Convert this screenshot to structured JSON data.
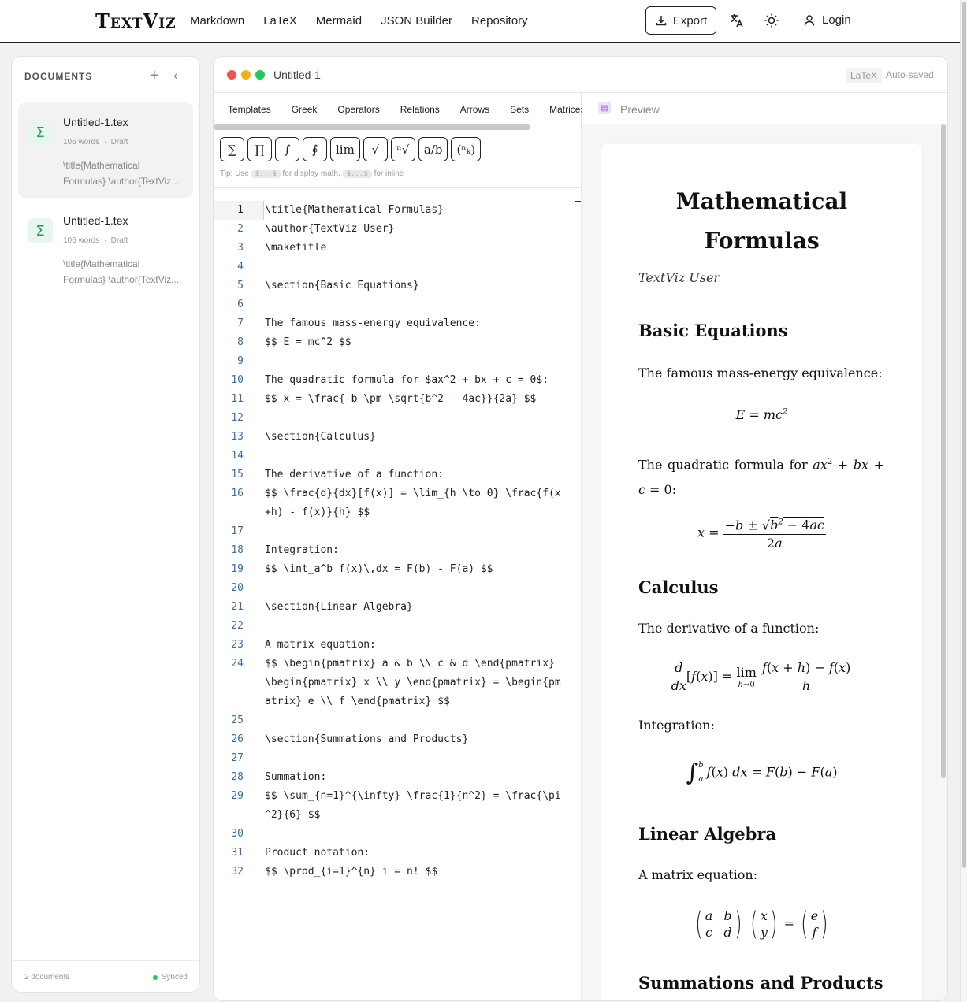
{
  "nav": {
    "brand": "TextViz",
    "links": [
      "Markdown",
      "LaTeX",
      "Mermaid",
      "JSON Builder",
      "Repository"
    ],
    "export_label": "Export",
    "login_label": "Login",
    "icons": {
      "export": "download-icon",
      "translate": "translate-icon",
      "theme": "sun-icon",
      "login": "user-icon"
    }
  },
  "sidebar": {
    "heading": "DOCUMENTS",
    "documents": [
      {
        "title": "Untitled-1.tex",
        "words": "106 words",
        "status": "Draft",
        "excerpt_1": "\\title{Mathematical",
        "excerpt_2": "Formulas} \\author{TextViz...",
        "icon": "Σ"
      },
      {
        "title": "Untitled-1.tex",
        "words": "106 words",
        "status": "Draft",
        "excerpt_1": "\\title{Mathematical",
        "excerpt_2": "Formulas} \\author{TextViz...",
        "icon": "Σ"
      }
    ],
    "footer_count": "2 documents",
    "footer_status": "Synced"
  },
  "editor": {
    "doc_name": "Untitled-1",
    "lang_badge": "LaTeX",
    "save_status": "Auto-saved",
    "tabs": [
      "Templates",
      "Greek",
      "Operators",
      "Relations",
      "Arrows",
      "Sets",
      "Matrices"
    ],
    "symbols": [
      "∑",
      "∏",
      "∫",
      "∮",
      "lim",
      "√",
      "ⁿ√",
      "a/b",
      "(ⁿₖ)"
    ],
    "tip_prefix": "Tip: Use",
    "tip_code_display": "$...$",
    "tip_mid": "for display math,",
    "tip_code_inline": "$...$",
    "tip_suffix": "for inline",
    "lines": [
      "\\title{Mathematical Formulas}",
      "\\author{TextViz User}",
      "\\maketitle",
      "",
      "\\section{Basic Equations}",
      "",
      "The famous mass-energy equivalence:",
      "$$ E = mc^2 $$",
      "",
      "The quadratic formula for $ax^2 + bx + c = 0$:",
      "$$ x = \\frac{-b \\pm \\sqrt{b^2 - 4ac}}{2a} $$",
      "",
      "\\section{Calculus}",
      "",
      "The derivative of a function:",
      "$$ \\frac{d}{dx}[f(x)] = \\lim_{h \\to 0} \\frac{f(x+h) - f(x)}{h} $$",
      "",
      "Integration:",
      "$$ \\int_a^b f(x)\\,dx = F(b) - F(a) $$",
      "",
      "\\section{Linear Algebra}",
      "",
      "A matrix equation:",
      "$$ \\begin{pmatrix} a & b \\\\ c & d \\end{pmatrix} \\begin{pmatrix} x \\\\ y \\end{pmatrix} = \\begin{pmatrix} e \\\\ f \\end{pmatrix} $$",
      "",
      "\\section{Summations and Products}",
      "",
      "Summation:",
      "$$ \\sum_{n=1}^{\\infty} \\frac{1}{n^2} = \\frac{\\pi^2}{6} $$",
      "",
      "Product notation:",
      "$$ \\prod_{i=1}^{n} i = n! $$"
    ]
  },
  "preview": {
    "label": "Preview",
    "title_line1": "Mathematical",
    "title_line2": "Formulas",
    "author": "TextViz User",
    "sec_basic": "Basic Equations",
    "p_mass": "The famous mass-energy equivalence:",
    "p_quad_1": "The quadratic formula for",
    "p_quad_2": ":",
    "sec_calc": "Calculus",
    "p_deriv": "The derivative of a function:",
    "p_integ": "Integration:",
    "sec_linalg": "Linear Algebra",
    "p_matrix": "A matrix equation:",
    "sec_sums": "Summations and Products"
  },
  "colors": {
    "accent_green": "#1f9d63",
    "line_number": "#3b6ea5",
    "traffic_red": "#ef5350",
    "traffic_yellow": "#f5b014",
    "traffic_green": "#22c55e"
  }
}
